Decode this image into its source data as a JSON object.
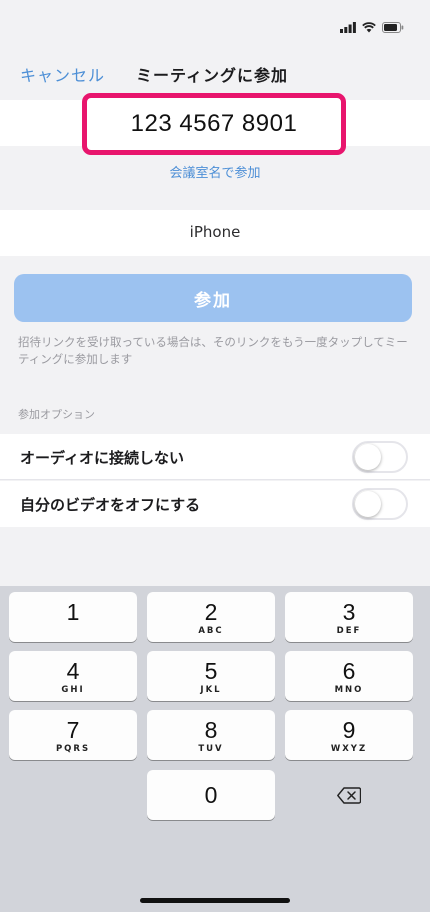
{
  "nav": {
    "cancel_label": "キャンセル",
    "title": "ミーティングに参加"
  },
  "meeting_id": {
    "value": "123 4567 8901",
    "highlight_color": "#e8156d"
  },
  "join_by_name_link": "会議室名で参加",
  "display_name": {
    "value": "iPhone"
  },
  "join_button": {
    "label": "参加",
    "color": "#9cc2f0"
  },
  "hint_text": "招待リンクを受け取っている場合は、そのリンクをもう一度タップしてミーティングに参加します",
  "options": {
    "section_label": "参加オプション",
    "items": [
      {
        "label": "オーディオに接続しない",
        "enabled": false
      },
      {
        "label": "自分のビデオをオフにする",
        "enabled": false
      }
    ]
  },
  "keypad": {
    "keys": [
      {
        "num": "1",
        "letters": ""
      },
      {
        "num": "2",
        "letters": "ABC"
      },
      {
        "num": "3",
        "letters": "DEF"
      },
      {
        "num": "4",
        "letters": "GHI"
      },
      {
        "num": "5",
        "letters": "JKL"
      },
      {
        "num": "6",
        "letters": "MNO"
      },
      {
        "num": "7",
        "letters": "PQRS"
      },
      {
        "num": "8",
        "letters": "TUV"
      },
      {
        "num": "9",
        "letters": "WXYZ"
      },
      {
        "num": "0",
        "letters": ""
      }
    ],
    "backspace_icon": "backspace-icon"
  },
  "colors": {
    "accent": "#4d8fd6",
    "background": "#f2f2f4",
    "keyboard": "#d2d4da"
  }
}
